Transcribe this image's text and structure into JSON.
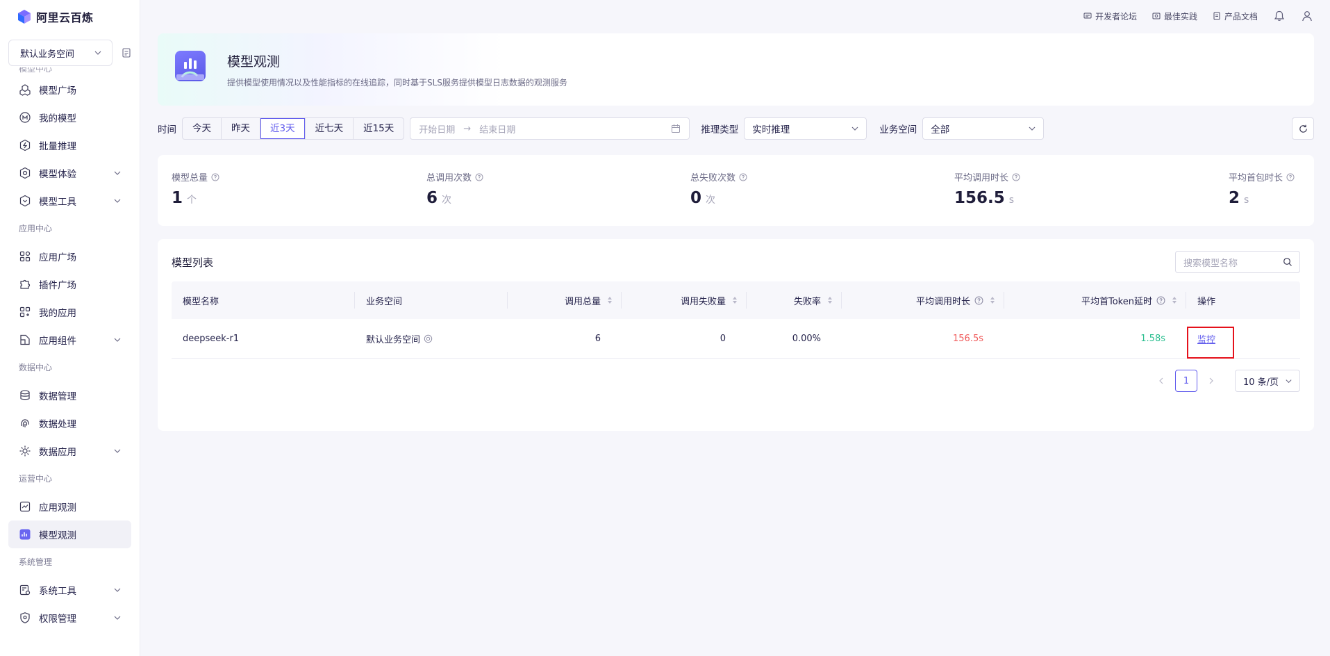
{
  "app": {
    "name": "阿里云百炼"
  },
  "workspace": {
    "current": "默认业务空间"
  },
  "sidebar": {
    "clipped_section": "模型中心",
    "items_a": [
      {
        "label": "模型广场",
        "icon": "cube-cluster-icon",
        "expandable": false
      },
      {
        "label": "我的模型",
        "icon": "model-icon",
        "expandable": false
      },
      {
        "label": "批量推理",
        "icon": "batch-icon",
        "expandable": false
      },
      {
        "label": "模型体验",
        "icon": "experience-icon",
        "expandable": true
      },
      {
        "label": "模型工具",
        "icon": "toolbox-icon",
        "expandable": true
      }
    ],
    "section_app": "应用中心",
    "items_b": [
      {
        "label": "应用广场",
        "icon": "grid-icon",
        "expandable": false
      },
      {
        "label": "插件广场",
        "icon": "puzzle-icon",
        "expandable": false
      },
      {
        "label": "我的应用",
        "icon": "my-app-icon",
        "expandable": false
      },
      {
        "label": "应用组件",
        "icon": "component-icon",
        "expandable": true
      }
    ],
    "section_data": "数据中心",
    "items_c": [
      {
        "label": "数据管理",
        "icon": "database-icon",
        "expandable": false
      },
      {
        "label": "数据处理",
        "icon": "fingerprint-icon",
        "expandable": false
      },
      {
        "label": "数据应用",
        "icon": "gear-cluster-icon",
        "expandable": true
      }
    ],
    "section_ops": "运营中心",
    "items_d": [
      {
        "label": "应用观测",
        "icon": "monitor-icon",
        "expandable": false
      },
      {
        "label": "模型观测",
        "icon": "chart-icon",
        "expandable": false,
        "active": true
      }
    ],
    "section_sys": "系统管理",
    "items_e": [
      {
        "label": "系统工具",
        "icon": "tools-icon",
        "expandable": true
      },
      {
        "label": "权限管理",
        "icon": "shield-icon",
        "expandable": true
      }
    ]
  },
  "topbar": {
    "forum": "开发者论坛",
    "practice": "最佳实践",
    "docs": "产品文档"
  },
  "hero": {
    "title": "模型观测",
    "desc": "提供模型使用情况以及性能指标的在线追踪，同时基于SLS服务提供模型日志数据的观测服务"
  },
  "filters": {
    "time_label": "时间",
    "ranges": [
      "今天",
      "昨天",
      "近3天",
      "近七天",
      "近15天"
    ],
    "active_range": "近3天",
    "start_placeholder": "开始日期",
    "end_placeholder": "结束日期",
    "infer_label": "推理类型",
    "infer_value": "实时推理",
    "space_label": "业务空间",
    "space_value": "全部"
  },
  "stats": [
    {
      "label": "模型总量",
      "value": "1",
      "unit": "个"
    },
    {
      "label": "总调用次数",
      "value": "6",
      "unit": "次"
    },
    {
      "label": "总失败次数",
      "value": "0",
      "unit": "次"
    },
    {
      "label": "平均调用时长",
      "value": "156.5",
      "unit": "s"
    },
    {
      "label": "平均首包时长",
      "value": "2",
      "unit": "s"
    }
  ],
  "list": {
    "title": "模型列表",
    "search_placeholder": "搜索模型名称",
    "columns": [
      "模型名称",
      "业务空间",
      "调用总量",
      "调用失败量",
      "失败率",
      "平均调用时长",
      "平均首Token延时",
      "操作"
    ],
    "rows": [
      {
        "name": "deepseek-r1",
        "space": "默认业务空间",
        "total": "6",
        "failed": "0",
        "rate": "0.00%",
        "avg": "156.5s",
        "first_token": "1.58s",
        "action": "监控"
      }
    ],
    "pager": {
      "page": "1",
      "size": "10 条/页"
    }
  },
  "colors": {
    "accent": "#615ced",
    "danger": "#f05a5a",
    "success": "#2bbf8f",
    "highlight": "#e5111b"
  }
}
